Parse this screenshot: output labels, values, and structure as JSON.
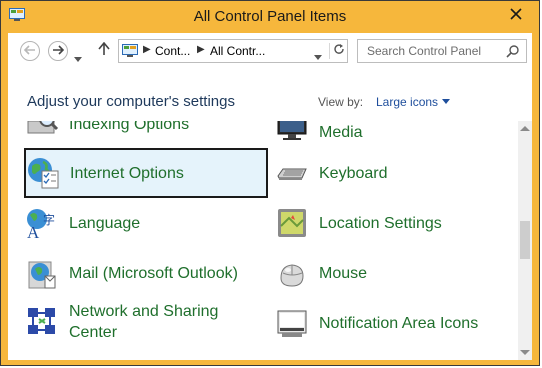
{
  "window": {
    "title": "All Control Panel Items",
    "close_label": "✕"
  },
  "address": {
    "crumb1": "Cont...",
    "crumb2": "All Contr..."
  },
  "search": {
    "placeholder": "Search Control Panel"
  },
  "header": {
    "heading": "Adjust your computer's settings",
    "view_by_label": "View by:",
    "view_by_value": "Large icons"
  },
  "items": {
    "indexing": {
      "label": "Indexing Options",
      "icon": "indexing-options-icon"
    },
    "media": {
      "label": "Media",
      "icon": "media-icon"
    },
    "internet": {
      "label": "Internet Options",
      "icon": "internet-options-icon",
      "selected": true
    },
    "keyboard": {
      "label": "Keyboard",
      "icon": "keyboard-icon"
    },
    "language": {
      "label": "Language",
      "icon": "language-icon"
    },
    "location": {
      "label": "Location Settings",
      "icon": "location-settings-icon"
    },
    "mail": {
      "label": "Mail (Microsoft Outlook)",
      "icon": "mail-icon"
    },
    "mouse": {
      "label": "Mouse",
      "icon": "mouse-icon"
    },
    "network": {
      "label": "Network and Sharing Center",
      "icon": "network-sharing-icon"
    },
    "notification": {
      "label": "Notification Area Icons",
      "icon": "notification-area-icon"
    }
  },
  "colors": {
    "titlebar": "#f6b73c",
    "item_text": "#1f6f2c",
    "selection_bg": "#e5f3fb",
    "link": "#1e4e9c"
  }
}
